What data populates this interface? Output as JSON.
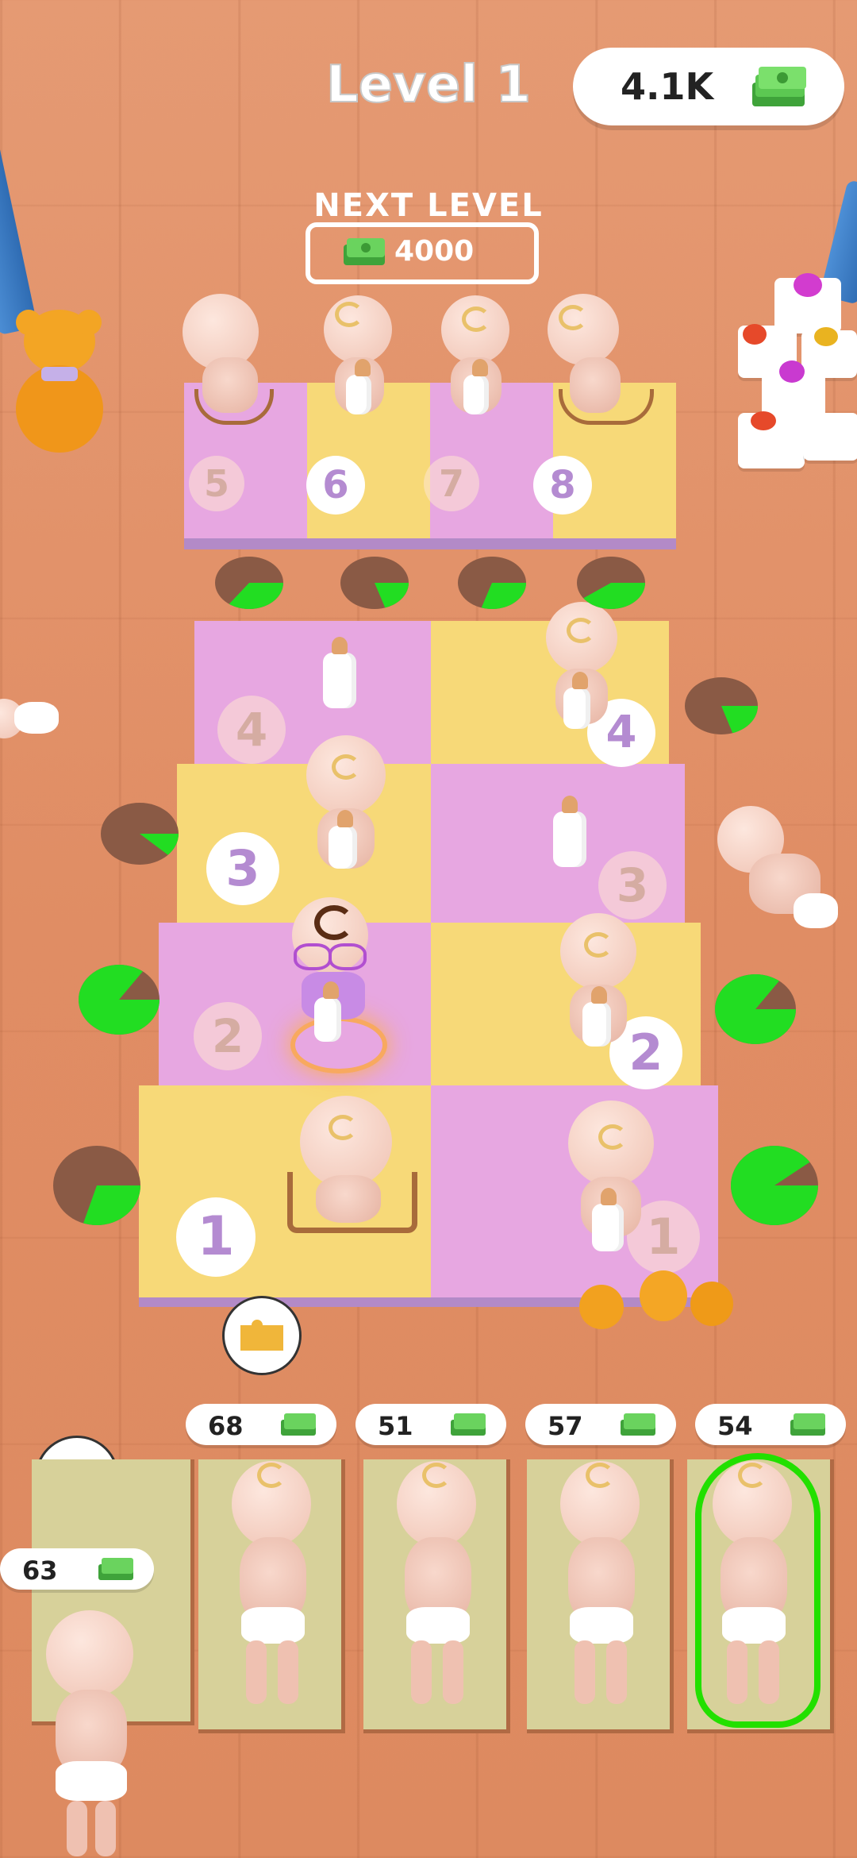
{
  "header": {
    "level_title": "Level 1",
    "money": "4.1K",
    "next_level_label": "NEXT LEVEL",
    "next_level_cost": "4000"
  },
  "board": {
    "top_row_numbers": [
      "5",
      "6",
      "7",
      "8"
    ],
    "left_numbers": [
      "4",
      "3",
      "2",
      "1"
    ],
    "right_numbers": [
      "4",
      "3",
      "2",
      "1"
    ]
  },
  "timers": [
    {
      "id": "t-top-1",
      "progress": 0.35
    },
    {
      "id": "t-top-2",
      "progress": 0.2
    },
    {
      "id": "t-top-3",
      "progress": 0.3
    },
    {
      "id": "t-top-4",
      "progress": 0.4
    },
    {
      "id": "t-right-4",
      "progress": 0.2
    },
    {
      "id": "t-left-3",
      "progress": 0.12
    },
    {
      "id": "t-left-2",
      "progress": 0.85
    },
    {
      "id": "t-right-2",
      "progress": 0.85
    },
    {
      "id": "t-left-1",
      "progress": 0.3
    },
    {
      "id": "t-right-1",
      "progress": 0.9
    }
  ],
  "shop": {
    "slots": [
      {
        "price": "63"
      },
      {
        "price": "68"
      },
      {
        "price": "51"
      },
      {
        "price": "57"
      },
      {
        "price": "54"
      }
    ]
  },
  "colors": {
    "timer_fill": "#22dd22",
    "timer_bg": "#8a5a45",
    "selected_outline": "#22e000",
    "tile_pink": "#e7a7e1",
    "tile_yellow": "#f7d978"
  },
  "icons": [
    "cash-stack-icon",
    "puzzle-piece-icon"
  ]
}
